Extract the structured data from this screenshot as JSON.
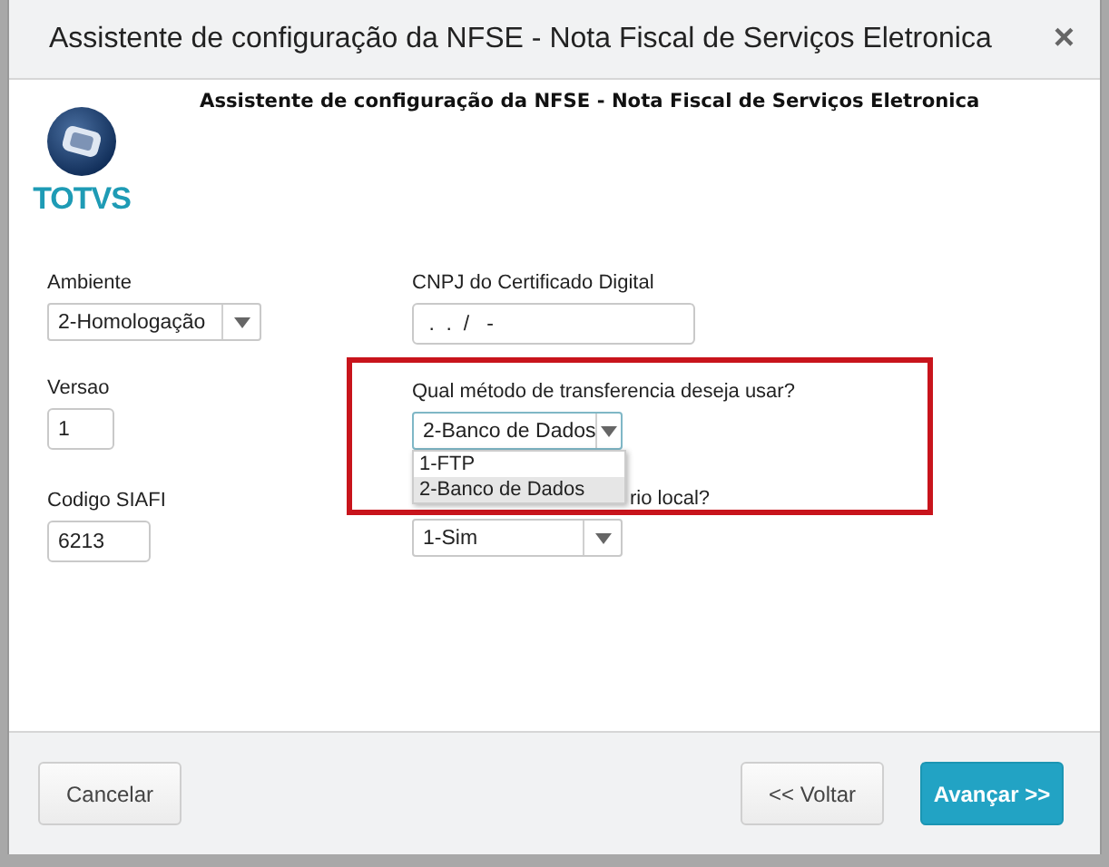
{
  "window": {
    "title": "Assistente de configuração da NFSE - Nota Fiscal de Serviços Eletronica",
    "close": "×"
  },
  "header": {
    "logo_text": "TOTVS",
    "heading": "Assistente de configuração da NFSE - Nota Fiscal de Serviços Eletronica"
  },
  "form": {
    "ambiente": {
      "label": "Ambiente",
      "value": "2-Homologação"
    },
    "cnpj": {
      "label": "CNPJ do Certificado Digital",
      "value": " .  .  /   -"
    },
    "versao": {
      "label": "Versao",
      "value": "1"
    },
    "metodo": {
      "label": "Qual método de transferencia deseja usar?",
      "value": "2-Banco de Dados",
      "expanded": true,
      "options": [
        {
          "label": "1-FTP",
          "selected": false
        },
        {
          "label": "2-Banco de Dados",
          "selected": true
        }
      ]
    },
    "siafi": {
      "label": "Codigo SIAFI",
      "value": "6213"
    },
    "local": {
      "label": "rio local?",
      "value": "1-Sim"
    }
  },
  "buttons": [
    {
      "label": "Cancelar",
      "kind": "default"
    },
    {
      "label": "<< Voltar",
      "kind": "default"
    },
    {
      "label": "Avançar >>",
      "kind": "primary"
    }
  ]
}
